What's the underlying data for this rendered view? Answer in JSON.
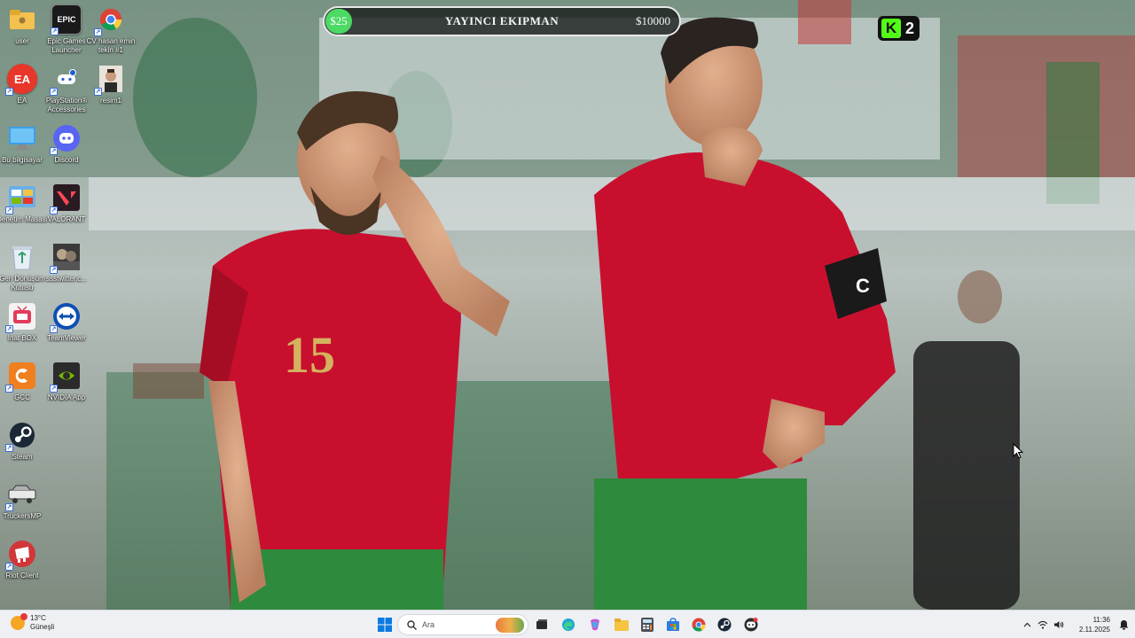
{
  "overlay": {
    "badge_amount": "$25",
    "title": "YAYINCI EKIPMAN",
    "goal_amount": "$10000",
    "kick_logo_letter": "K",
    "kick_count": "2"
  },
  "desktop_icons": [
    {
      "label": "user",
      "icon": "folder-icon",
      "color": "#f2c14e"
    },
    {
      "label": "Epic Games Launcher",
      "icon": "epic-games-icon",
      "color": "#1a1a1a",
      "glyph": "EPIC"
    },
    {
      "label": "CV hasan emin tekin #1",
      "icon": "chrome-icon",
      "color": "#ffffff"
    },
    {
      "label": "EA",
      "icon": "ea-icon",
      "color": "#e8362a",
      "glyph": "EA"
    },
    {
      "label": "PlayStation® Accessories",
      "icon": "playstation-icon",
      "color": "#1f5fd1"
    },
    {
      "label": "resim1",
      "icon": "photo-icon",
      "color": "#ffffff"
    },
    {
      "label": "Bu bilgisayar",
      "icon": "computer-icon",
      "color": "#3aa0e8"
    },
    {
      "label": "Discord",
      "icon": "discord-icon",
      "color": "#5865f2"
    },
    {
      "label": "Denetim Masası",
      "icon": "control-panel-icon",
      "color": "#6ab0e8"
    },
    {
      "label": "VALORANT",
      "icon": "valorant-icon",
      "color": "#ff4655"
    },
    {
      "label": "Geri Dönüşüm Kutusu",
      "icon": "recycle-bin-icon",
      "color": "#e8eef5"
    },
    {
      "label": "ssstwitter.c...",
      "icon": "video-file-icon",
      "color": "#555555"
    },
    {
      "label": "İnat BOX",
      "icon": "inat-box-icon",
      "color": "#f3f3f3"
    },
    {
      "label": "TeamViewer",
      "icon": "teamviewer-icon",
      "color": "#0e4fb3"
    },
    {
      "label": "GCC",
      "icon": "gcc-icon",
      "color": "#f07f1f"
    },
    {
      "label": "NVIDIA App",
      "icon": "nvidia-icon",
      "color": "#2b2b2b"
    },
    {
      "label": "Steam",
      "icon": "steam-icon",
      "color": "#1b2838"
    },
    {
      "label": "TruckersMP",
      "icon": "truckersmp-icon",
      "color": "#dddddd"
    },
    {
      "label": "Riot Client",
      "icon": "riot-client-icon",
      "color": "#d13639"
    }
  ],
  "taskbar": {
    "weather_temp": "13°C",
    "weather_desc": "Güneşli",
    "search_placeholder": "Ara",
    "pinned_apps": [
      "start-icon",
      "search-icon",
      "task-view-icon",
      "edge-icon",
      "copilot-icon",
      "file-explorer-icon",
      "calculator-icon",
      "store-icon",
      "chrome-icon",
      "steam-icon",
      "discord-icon"
    ],
    "time": "11:36",
    "date": "2.11.2025"
  }
}
